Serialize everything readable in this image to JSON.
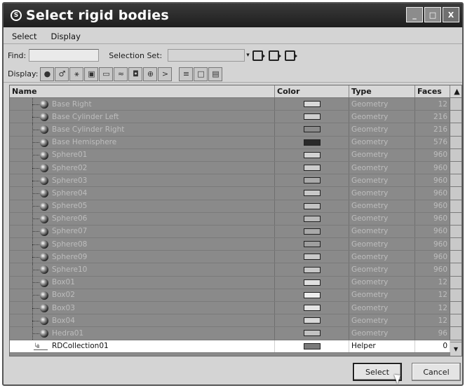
{
  "window": {
    "title": "Select rigid bodies",
    "minimize_glyph": "_",
    "maximize_glyph": "□",
    "close_glyph": "X"
  },
  "menu": [
    "Select",
    "Display"
  ],
  "find": {
    "label": "Find:",
    "value": "",
    "selection_set_label": "Selection Set:",
    "selection_set_value": ""
  },
  "display": {
    "label": "Display:"
  },
  "icons": {
    "display_buttons": [
      "geometry-filter-icon",
      "shapes-filter-icon",
      "lights-filter-icon",
      "cameras-filter-icon",
      "helpers-filter-icon",
      "spacewarps-filter-icon",
      "groups-filter-icon",
      "xrefs-filter-icon",
      "bones-filter-icon",
      "select-all-icon",
      "select-none-icon",
      "select-invert-icon"
    ]
  },
  "table": {
    "columns": {
      "name": "Name",
      "color": "Color",
      "type": "Type",
      "faces": "Faces"
    },
    "rows": [
      {
        "name": "Base Right",
        "type": "Geometry",
        "faces": "12",
        "color": "#d9d9d9"
      },
      {
        "name": "Base Cylinder Left",
        "type": "Geometry",
        "faces": "216",
        "color": "#cfcfcf"
      },
      {
        "name": "Base Cylinder Right",
        "type": "Geometry",
        "faces": "216",
        "color": "#8a8a8a"
      },
      {
        "name": "Base Hemisphere",
        "type": "Geometry",
        "faces": "576",
        "color": "#2a2a2a"
      },
      {
        "name": "Sphere01",
        "type": "Geometry",
        "faces": "960",
        "color": "#d2d2d2"
      },
      {
        "name": "Sphere02",
        "type": "Geometry",
        "faces": "960",
        "color": "#cdcdcd"
      },
      {
        "name": "Sphere03",
        "type": "Geometry",
        "faces": "960",
        "color": "#aaaaaa"
      },
      {
        "name": "Sphere04",
        "type": "Geometry",
        "faces": "960",
        "color": "#c8c8c8"
      },
      {
        "name": "Sphere05",
        "type": "Geometry",
        "faces": "960",
        "color": "#c4c4c4"
      },
      {
        "name": "Sphere06",
        "type": "Geometry",
        "faces": "960",
        "color": "#b8b8b8"
      },
      {
        "name": "Sphere07",
        "type": "Geometry",
        "faces": "960",
        "color": "#a9a9a9"
      },
      {
        "name": "Sphere08",
        "type": "Geometry",
        "faces": "960",
        "color": "#9f9f9f"
      },
      {
        "name": "Sphere09",
        "type": "Geometry",
        "faces": "960",
        "color": "#cacaca"
      },
      {
        "name": "Sphere10",
        "type": "Geometry",
        "faces": "960",
        "color": "#c7c7c7"
      },
      {
        "name": "Box01",
        "type": "Geometry",
        "faces": "12",
        "color": "#e0e0e0"
      },
      {
        "name": "Box02",
        "type": "Geometry",
        "faces": "12",
        "color": "#eeeeee"
      },
      {
        "name": "Box03",
        "type": "Geometry",
        "faces": "12",
        "color": "#e4e4e4"
      },
      {
        "name": "Box04",
        "type": "Geometry",
        "faces": "12",
        "color": "#d8d8d8"
      },
      {
        "name": "Hedra01",
        "type": "Geometry",
        "faces": "96",
        "color": "#c2c2c2"
      }
    ],
    "helper_row": {
      "name": "RDCollection01",
      "type": "Helper",
      "faces": "0",
      "color": "#7a7a7a"
    }
  },
  "buttons": {
    "select": "Select",
    "cancel": "Cancel"
  }
}
